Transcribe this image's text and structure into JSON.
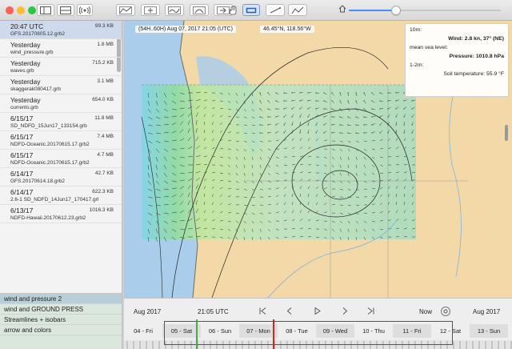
{
  "toolbar": {
    "traffic_colors": [
      "#fe5f57",
      "#febc2e",
      "#28c840"
    ],
    "buttons": [
      "sidebar-toggle-icon",
      "layout-icon",
      "broadcast-icon",
      "route-icon",
      "add-waypoint-icon",
      "sailing-route-icon",
      "isochrone-icon",
      "import-icon",
      "hand-pan-icon",
      "rectangle-select-icon",
      "line-tool-icon",
      "polyline-tool-icon"
    ],
    "slider_value": 0.31
  },
  "files": [
    {
      "when": "20:47 UTC",
      "size": "99.3 KB",
      "name": "GFS.20170805.12.grb2"
    },
    {
      "when": "Yesterday",
      "size": "1.8 MB",
      "name": "wind_pressure.grb"
    },
    {
      "when": "Yesterday",
      "size": "715.2 KB",
      "name": "waves.grb"
    },
    {
      "when": "Yesterday",
      "size": "3.1 MB",
      "name": "skaggerak080417.grb"
    },
    {
      "when": "Yesterday",
      "size": "654.0 KB",
      "name": "currents.grb"
    },
    {
      "when": "6/15/17",
      "size": "11.8 MB",
      "name": "SD_NDFD_15Jun17_133154.grb"
    },
    {
      "when": "6/15/17",
      "size": "7.4 MB",
      "name": "NDFD-Oceanic.20170615.17.grb2"
    },
    {
      "when": "6/15/17",
      "size": "4.7 MB",
      "name": "NDFD-Oceanic.20170615.17.grb2"
    },
    {
      "when": "6/14/17",
      "size": "42.7 KB",
      "name": "GFS.20170614.18.grb2"
    },
    {
      "when": "6/14/17",
      "size": "622.3 KB",
      "name": "2.6-1 SD_NDFD_14Jun17_170417.grl"
    },
    {
      "when": "6/13/17",
      "size": "1016.3 KB",
      "name": "NDFD-Hawaii.20170612.23.grb2"
    }
  ],
  "styles": [
    "wind and pressure 2",
    "wind and GROUND PRESS",
    "Streamlines + isobars",
    "arrow and colors"
  ],
  "map": {
    "time_label": "(54H..60H) Aug 07, 2017 21:05 (UTC)",
    "position_label": "46.45°N, 118.56°W",
    "info": {
      "h1": "10m:",
      "wind": "Wind: 2.8 kn, 37° (NE)",
      "h2": "mean sea level:",
      "pressure": "Pressure: 1010.8 hPa",
      "h3": "1-2m:",
      "soil": "Soil temperature: 55.9 °F"
    },
    "colors": {
      "land": "#f4d9a8",
      "water": "#a9cdea",
      "grid": "#9fd8b8",
      "coast": "#6b6b6b"
    }
  },
  "timeline": {
    "left_month": "Aug 2017",
    "time": "21:05 UTC",
    "now": "Now",
    "right_month": "Aug 2017",
    "days": [
      "04 - Fri",
      "05 - Sat",
      "06 - Sun",
      "07 - Mon",
      "08 - Tue",
      "09 - Wed",
      "10 - Thu",
      "11 - Fri",
      "12 - Sat",
      "13 - Sun"
    ],
    "marker_colors": {
      "start": "#3cb043",
      "current": "#e02020"
    }
  }
}
